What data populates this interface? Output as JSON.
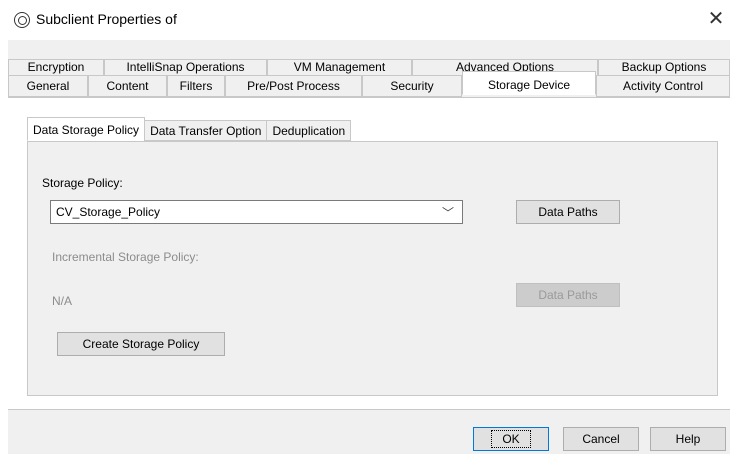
{
  "window": {
    "title": "Subclient Properties of",
    "icon": "subclient-icon",
    "close_label": "✕"
  },
  "tabs": {
    "row1": [
      "Encryption",
      "IntelliSnap Operations",
      "VM Management",
      "Advanced Options",
      "Backup Options"
    ],
    "row2": [
      "General",
      "Content",
      "Filters",
      "Pre/Post Process",
      "Security",
      "Storage Device",
      "Activity Control"
    ],
    "active": "Storage Device"
  },
  "subtabs": {
    "items": [
      "Data Storage Policy",
      "Data Transfer Option",
      "Deduplication"
    ],
    "active": "Data Storage Policy"
  },
  "storage": {
    "policy_label": "Storage Policy:",
    "policy_value": "CV_Storage_Policy",
    "data_paths_label": "Data Paths",
    "incremental_label": "Incremental Storage Policy:",
    "incremental_value": "N/A",
    "incremental_data_paths_label": "Data Paths",
    "create_button": "Create Storage Policy"
  },
  "footer": {
    "ok": "OK",
    "cancel": "Cancel",
    "help": "Help"
  }
}
